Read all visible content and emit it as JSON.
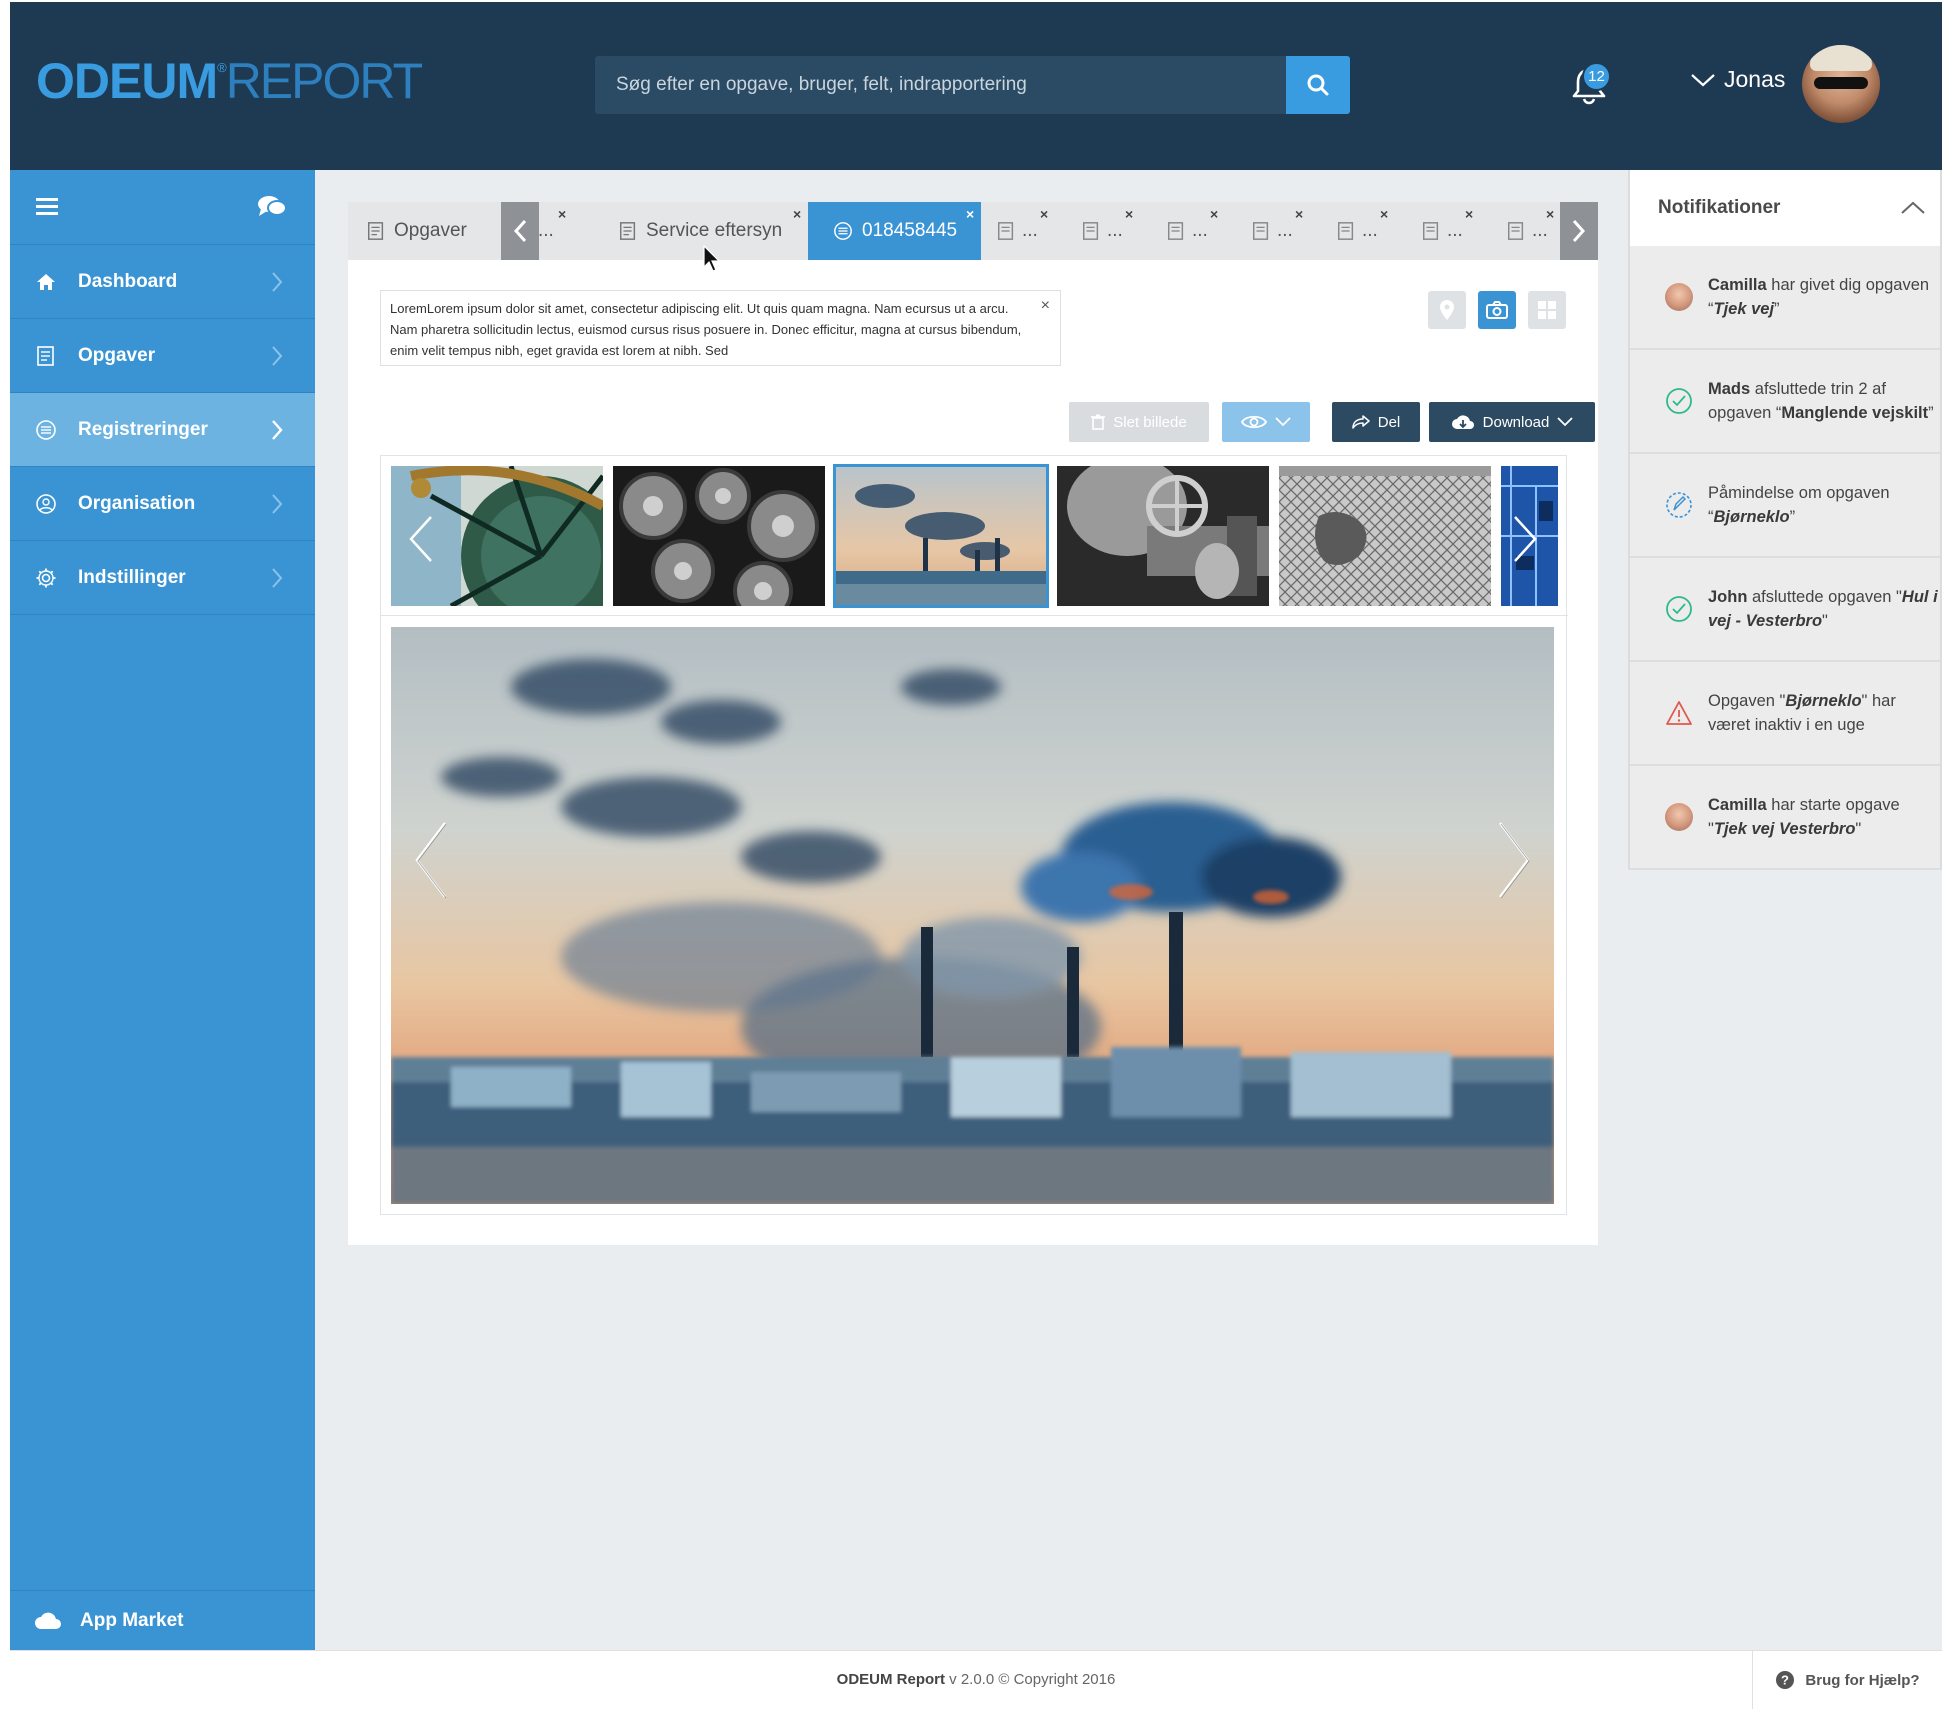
{
  "header": {
    "logo_brand": "ODEUM",
    "logo_sup": "®",
    "logo_product": "REPORT",
    "search_placeholder": "Søg efter en opgave, bruger, felt, indrapportering",
    "notification_count": "12",
    "user_name": "Jonas"
  },
  "sidebar": {
    "items": [
      {
        "label": "Dashboard",
        "icon": "home-icon"
      },
      {
        "label": "Opgaver",
        "icon": "tasks-icon"
      },
      {
        "label": "Registreringer",
        "icon": "registrations-icon",
        "active": true
      },
      {
        "label": "Organisation",
        "icon": "organisation-icon"
      },
      {
        "label": "Indstillinger",
        "icon": "gear-icon"
      }
    ],
    "app_market": "App Market"
  },
  "tabs": {
    "home_label": "Opgaver",
    "service_label": "Service eftersyn",
    "active_label": "018458445",
    "ellipsis": "...",
    "close": "×"
  },
  "note": {
    "text": "LoremLorem ipsum dolor sit amet, consectetur adipiscing elit. Ut quis quam magna. Nam ecursus ut a arcu. Nam pharetra sollicitudin lectus, euismod cursus risus posuere in. Donec efficitur, magna at cursus bibendum, enim velit tempus nibh, eget gravida est lorem at nibh. Sed",
    "close": "×"
  },
  "actions": {
    "delete_label": "Slet billede",
    "share_label": "Del",
    "download_label": "Download"
  },
  "gallery": {
    "thumbnails": [
      "turbine-wheel",
      "gears",
      "factory-smoke",
      "pipes-valves",
      "fence-sign",
      "circuit-board"
    ],
    "selected_index": 2
  },
  "notifications": {
    "title": "Notifikationer",
    "items": [
      {
        "icon": "avatar-camilla",
        "who": "Camilla",
        "text": " har givet dig opgaven “",
        "task": "Tjek vej",
        "end": "”"
      },
      {
        "icon": "check-circle-icon",
        "who": "Mads",
        "text": " afsluttede trin 2 af opgaven “",
        "task": "Manglende vejskilt",
        "end": "”"
      },
      {
        "icon": "reminder-icon",
        "who": "",
        "text": "Påmindelse om opgaven “",
        "task": "Bjørneklo",
        "end": "”"
      },
      {
        "icon": "check-circle-icon",
        "who": "John",
        "text": " afsluttede opgaven \"",
        "task": "Hul i vej - Vesterbro",
        "end": "\""
      },
      {
        "icon": "warning-icon",
        "who": "",
        "text": "Opgaven \"",
        "task": "Bjørneklo",
        "end": "\" har været inaktiv i en uge"
      },
      {
        "icon": "avatar-camilla",
        "who": "Camilla",
        "text": " har starte opgave \"",
        "task": "Tjek vej Vesterbro",
        "end": "\""
      }
    ]
  },
  "footer": {
    "brand": "ODEUM Report",
    "version": " v 2.0.0 © Copyright 2016",
    "help": "Brug for Hjælp?"
  },
  "colors": {
    "header_bg": "#1e3a52",
    "accent": "#3a94d4",
    "sidebar_active": "#6cb3e2"
  }
}
